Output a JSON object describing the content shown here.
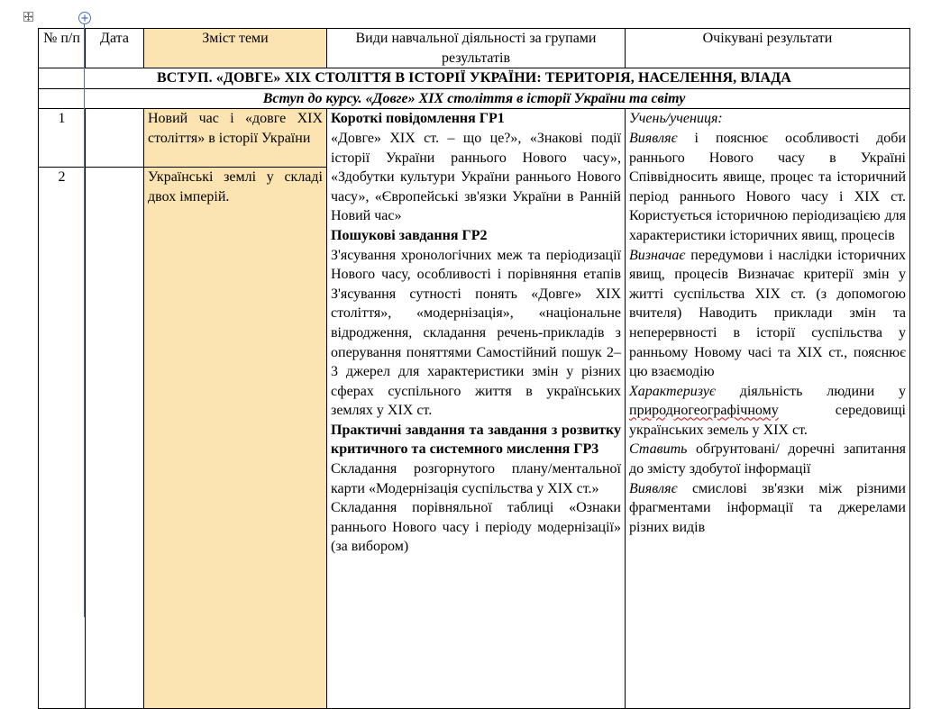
{
  "table": {
    "headers": {
      "num": "№ п/п",
      "date": "Дата",
      "topic": "Зміст теми",
      "activities": "Види навчальної діяльності за групами результатів",
      "results": "Очікувані результати"
    },
    "section_title": "ВСТУП. «ДОВГЕ» ХІХ СТОЛІТТЯ В ІСТОРІЇ УКРАЇНИ: ТЕРИТОРІЯ, НАСЕЛЕННЯ, ВЛАДА",
    "subsection_title": "Вступ до курсу. «Довге» ХІХ століття в історії України та світу",
    "rows": [
      {
        "num": "1",
        "topic": "Новий час і «довге ХІХ століття» в історії України"
      },
      {
        "num": "2",
        "topic": "Українські землі у складі двох імперій."
      }
    ],
    "activities": {
      "gr1_title": "Короткі повідомлення ГР1",
      "gr1_text": " «Довге» ХІХ ст. – що це?», «Знакові події історії України раннього Нового часу», «Здобутки культури України раннього Нового часу», «Європейські зв'язки України в Ранній Новий час»",
      "gr2_title": "Пошукові завдання ГР2",
      "gr2_text": "З'ясування хронологічних меж та періодизації Нового часу, особливості і порівняння етапів З'ясування сутності понять «Довге» ХІХ століття», «модернізація», «національне відродження, складання речень-прикладів з оперування поняттями Самостійний пошук 2–3 джерел для характеристики змін у різних сферах суспільного життя в українських землях у ХІХ ст.",
      "gr3_title": "Практичні завдання та завдання з розвитку критичного та системного мислення ГР3",
      "gr3_text1": "Складання розгорнутого плану/ментальної карти «Модернізація суспільства у ХІХ ст.»",
      "gr3_text2": "Складання порівняльної таблиці «Ознаки раннього Нового часу і періоду модернізації» (за вибором)"
    },
    "results": {
      "intro": "Учень/учениця:",
      "r1_verb": "Виявляє",
      "r1_text": " і пояснює особливості доби раннього Нового часу в Україні Співвідносить явище, процес та історичний період раннього Нового часу і ХІХ ст. Користується історичною періодизацією для характеристики історичних явищ, процесів",
      "r2_verb": "Визначає",
      "r2_text": " передумови і наслідки історичних явищ, процесів Визначає критерії змін у житті суспільства ХІХ ст. (з допомогою вчителя) Наводить приклади змін та неперервності в історії суспільства у ранньому Новому часі та ХІХ ст., пояснює цю взаємодію",
      "r3_verb": "Характеризує",
      "r3_text_a": " діяльність людини у ",
      "r3_spell": "природногеографічному",
      "r3_text_b": " середовищі українських земель у ХІХ ст.",
      "r4_verb": "Ставить",
      "r4_text": " обґрунтовані/ доречні запитання до змісту здобутої інформації",
      "r5_verb": "Виявляє",
      "r5_text": " смислові зв'язки між різними фрагментами інформації та джерелами різних видів"
    }
  }
}
